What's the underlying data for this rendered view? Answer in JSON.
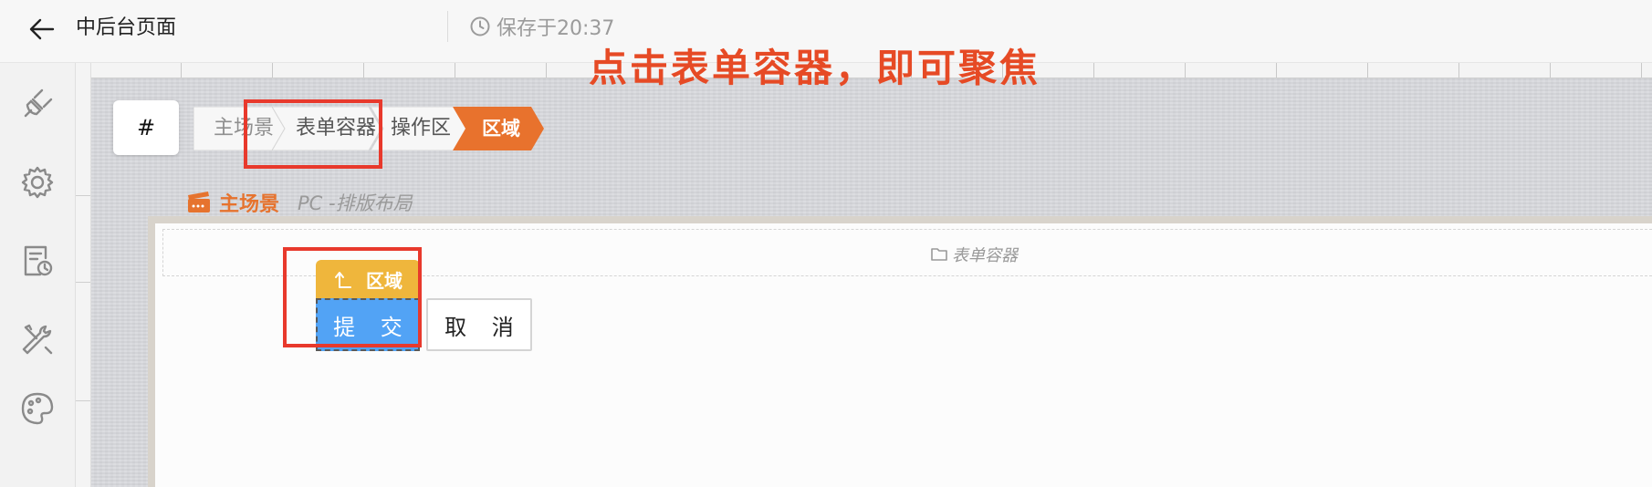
{
  "header": {
    "page_title": "中后台页面",
    "save_status": "保存于20:37"
  },
  "sidebar": {
    "items": [
      {
        "icon": "plugin-icon"
      },
      {
        "icon": "gear-icon"
      },
      {
        "icon": "schedule-doc-icon"
      },
      {
        "icon": "tools-icon"
      },
      {
        "icon": "palette-icon"
      }
    ]
  },
  "breadcrumb": {
    "hash_label": "#",
    "items": [
      {
        "label": "主场景",
        "state": "normal"
      },
      {
        "label": "表单容器",
        "state": "highlighted"
      },
      {
        "label": "操作区",
        "state": "normal"
      },
      {
        "label": "区域",
        "state": "active"
      }
    ]
  },
  "annotation": {
    "text": "点击表单容器，即可聚焦",
    "color": "#e8392c"
  },
  "scene": {
    "name": "主场景",
    "mode": "PC -排版布局"
  },
  "form_container": {
    "label": "表单容器"
  },
  "region": {
    "label": "区域"
  },
  "buttons": {
    "submit_label": "提 交",
    "cancel_label": "取 消"
  },
  "colors": {
    "accent_orange": "#e6732e",
    "region_yellow": "#efb63c",
    "primary_blue": "#52a3f5",
    "annotation_red": "#e8392c"
  }
}
